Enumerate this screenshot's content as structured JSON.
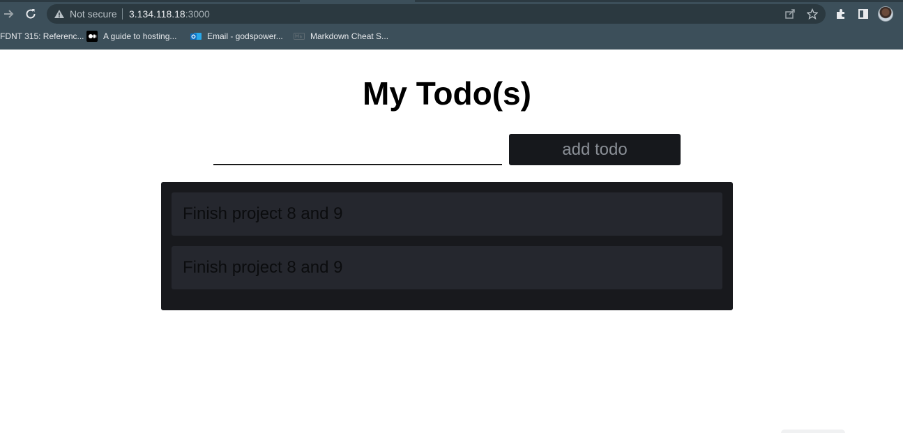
{
  "browser": {
    "omnibox": {
      "security_label": "Not secure",
      "url_host": "3.134.118.18",
      "url_port": ":3000"
    },
    "bookmarks": [
      {
        "label": "FDNT 315: Referenc...",
        "icon": "bookmark-favicon"
      },
      {
        "label": "A guide to hosting...",
        "icon": "medium-icon"
      },
      {
        "label": "Email - godspower...",
        "icon": "outlook-icon"
      },
      {
        "label": "Markdown Cheat S...",
        "icon": "markdown-icon"
      }
    ]
  },
  "page": {
    "title": "My Todo(s)",
    "input": {
      "value": "",
      "placeholder": ""
    },
    "add_button_label": "add todo",
    "todos": [
      {
        "text": "Finish project 8 and 9"
      },
      {
        "text": "Finish project 8 and 9"
      }
    ]
  },
  "colors": {
    "chrome_bg": "#3c4f5a",
    "omnibox_bg": "#2b3940",
    "list_bg": "#18191d",
    "item_bg": "#25272e",
    "button_bg": "#16181c"
  }
}
